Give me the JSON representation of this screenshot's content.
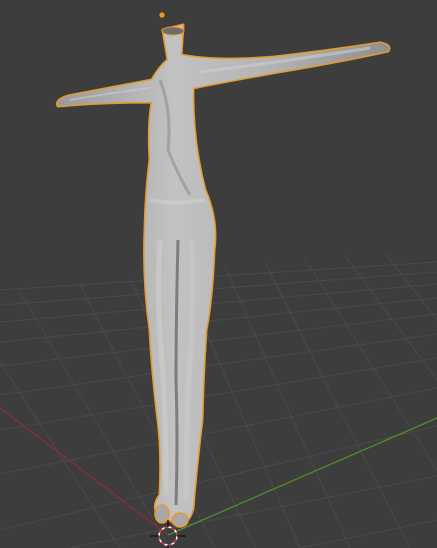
{
  "viewport": {
    "background": "#3d3d3d",
    "grid_color": "#4a4a4a",
    "x_axis_color": "#8a2f33",
    "y_axis_color": "#4f8f2a"
  },
  "scene": {
    "object": "humanoid-mesh",
    "selection_outline": "#e59a2a",
    "mesh_color": "#b5b5b5"
  }
}
